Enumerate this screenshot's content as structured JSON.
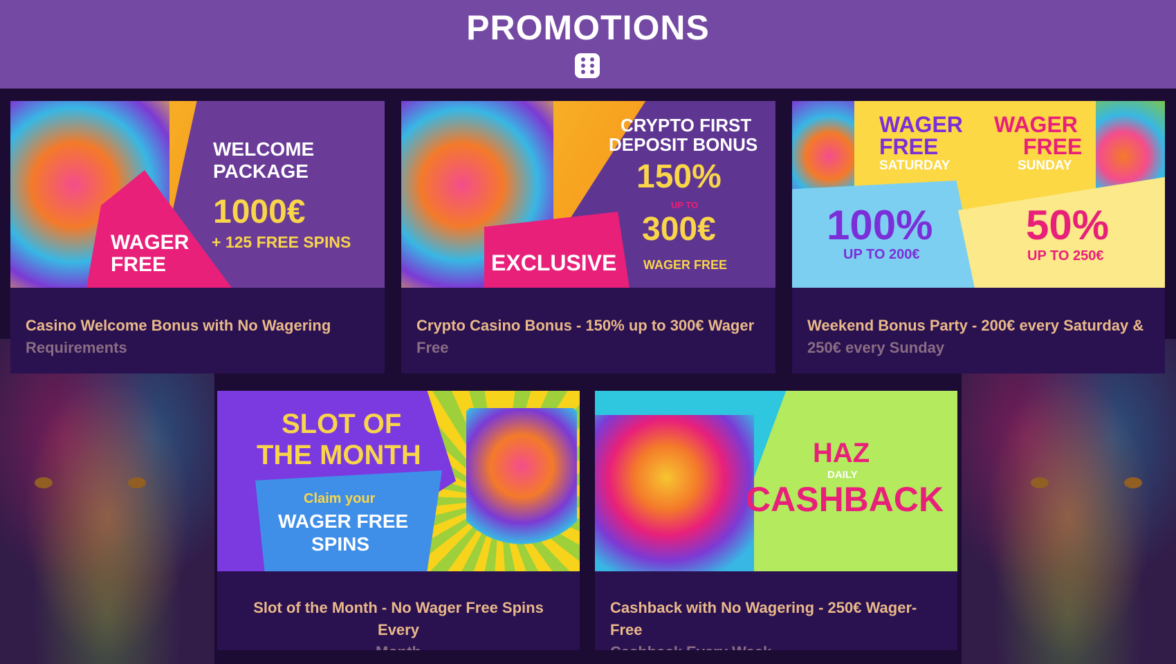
{
  "header": {
    "title": "PROMOTIONS",
    "icon": "dice-icon"
  },
  "promotions": [
    {
      "caption_line1": "Casino Welcome Bonus with No Wagering",
      "caption_line2": "Requirements",
      "banner": {
        "line1": "WELCOME",
        "line2": "PACKAGE",
        "amount": "1000€",
        "extra": "+ 125 FREE SPINS",
        "tag1": "WAGER",
        "tag2": "FREE"
      }
    },
    {
      "caption_line1": "Crypto Casino Bonus - 150% up to 300€ Wager",
      "caption_line2": "Free",
      "banner": {
        "line1": "CRYPTO FIRST",
        "line2": "DEPOSIT BONUS",
        "percent": "150%",
        "upto": "UP TO",
        "amount": "300€",
        "note": "WAGER FREE",
        "tag": "EXCLUSIVE"
      }
    },
    {
      "caption_line1": "Weekend Bonus Party - 200€ every Saturday &",
      "caption_line2": "250€ every Sunday",
      "banner": {
        "sat1": "WAGER",
        "sat2": "FREE",
        "sat3": "SATURDAY",
        "sun1": "WAGER",
        "sun2": "FREE",
        "sun3": "SUNDAY",
        "sat_pct": "100%",
        "sat_amt": "UP TO 200€",
        "sun_pct": "50%",
        "sun_amt": "UP TO 250€"
      }
    },
    {
      "caption_line1": "Slot of the Month - No Wager Free Spins Every",
      "caption_line2": "Month",
      "banner": {
        "line1": "SLOT OF",
        "line2": "THE MONTH",
        "claim": "Claim your",
        "w1": "WAGER FREE",
        "w2": "SPINS"
      }
    },
    {
      "caption_line1": "Cashback with No Wagering - 250€ Wager-Free",
      "caption_line2": "Cashback Every Week",
      "banner": {
        "haz": "HAZ",
        "daily": "DAILY",
        "cashback": "CASHBACK"
      }
    }
  ],
  "colors": {
    "header_bg": "#7449a3",
    "page_bg": "#1c0b33",
    "card_bg": "#2a1150",
    "caption": "#e9b98a",
    "caption_dim": "#8a6d84"
  }
}
